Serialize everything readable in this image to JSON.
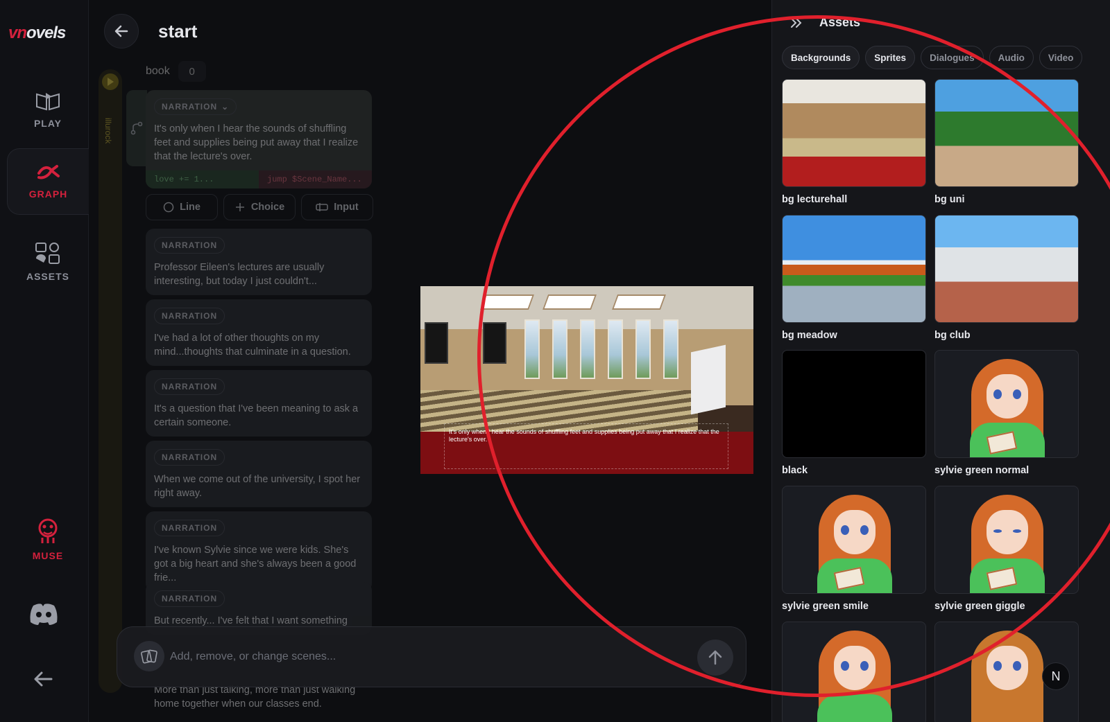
{
  "app": {
    "logo": "vnovels"
  },
  "nav": {
    "items": [
      {
        "label": "PLAY",
        "icon": "book-play-icon"
      },
      {
        "label": "GRAPH",
        "icon": "graph-icon",
        "active": true
      },
      {
        "label": "ASSETS",
        "icon": "assets-icon"
      },
      {
        "label": "MUSE",
        "icon": "muse-icon"
      }
    ],
    "discord_icon": "discord-icon",
    "collapse_icon": "arrow-left-icon"
  },
  "header": {
    "title": "start",
    "back_icon": "arrow-left-icon"
  },
  "editor": {
    "timeline_label": "illurock",
    "book_label": "book",
    "book_count": "0",
    "first_card": {
      "badge": "NARRATION",
      "text": "It's only when I hear the sounds of shuffling feet and supplies being put away that I realize that the lecture's over.",
      "code_left": "love += 1...",
      "code_right": "jump $Scene_Name..."
    },
    "actions": [
      "Line",
      "Choice",
      "Input"
    ],
    "cards": [
      {
        "badge": "NARRATION",
        "text": "Professor Eileen's lectures are usually interesting, but today I just couldn't..."
      },
      {
        "badge": "NARRATION",
        "text": "I've had a lot of other thoughts on my mind...thoughts that culminate in a question."
      },
      {
        "badge": "NARRATION",
        "text": "It's a question that I've been meaning to ask a certain someone."
      },
      {
        "badge": "NARRATION",
        "text": "When we come out of the university, I spot her right away."
      },
      {
        "badge": "NARRATION",
        "text": "I've known Sylvie since we were kids. She's got a big heart and she's always been a good frie..."
      },
      {
        "badge": "NARRATION",
        "text": "But recently... I've felt that I want something"
      }
    ],
    "tail_text": "More than just talking, more than just walking home together when our classes end."
  },
  "chat": {
    "placeholder": "Add, remove, or change scenes...",
    "send_icon": "arrow-up-icon"
  },
  "preview": {
    "caption": "It's only when I hear the sounds of shuffling feet and supplies being put away that I realize that the lecture's over."
  },
  "assets_panel": {
    "title": "Assets",
    "collapse_icon": "double-chevron-right-icon",
    "tabs": [
      "Backgrounds",
      "Sprites",
      "Dialogues",
      "Audio",
      "Video"
    ],
    "active_tab": "Sprites",
    "items": [
      {
        "name": "bg lecturehall",
        "kind": "lecture"
      },
      {
        "name": "bg uni",
        "kind": "uni"
      },
      {
        "name": "bg meadow",
        "kind": "meadow"
      },
      {
        "name": "bg club",
        "kind": "club"
      },
      {
        "name": "black",
        "kind": "black"
      },
      {
        "name": "sylvie green normal",
        "kind": "sprite"
      },
      {
        "name": "sylvie green smile",
        "kind": "sprite"
      },
      {
        "name": "sylvie green giggle",
        "kind": "sprite"
      },
      {
        "name": "",
        "kind": "sprite"
      },
      {
        "name": "",
        "kind": "sprite"
      }
    ],
    "corner_badge": "N"
  },
  "colors": {
    "accent": "#d4213d",
    "lens": "#e0202c",
    "panel_bg": "#15161a",
    "app_bg": "#0d0e11"
  }
}
